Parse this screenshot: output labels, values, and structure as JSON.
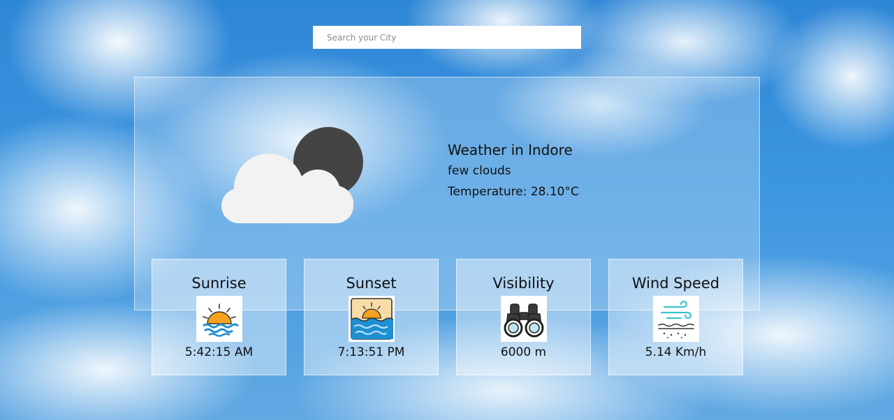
{
  "search": {
    "placeholder": "Search your City",
    "value": ""
  },
  "weather": {
    "title": "Weather in Indore",
    "description": "few clouds",
    "temperature": "Temperature: 28.10°C",
    "icon": "cloud-moon-icon"
  },
  "stats": [
    {
      "title": "Sunrise",
      "value": "5:42:15 AM",
      "icon": "sunrise-icon"
    },
    {
      "title": "Sunset",
      "value": "7:13:51 PM",
      "icon": "sunset-icon"
    },
    {
      "title": "Visibility",
      "value": "6000 m",
      "icon": "binoculars-icon"
    },
    {
      "title": "Wind Speed",
      "value": "5.14 Km/h",
      "icon": "wind-icon"
    }
  ],
  "colors": {
    "sky": "#3d96e0",
    "card": "#ffffff",
    "sun": "#f6a21e",
    "water": "#1f8fd1",
    "moon": "#444444"
  }
}
